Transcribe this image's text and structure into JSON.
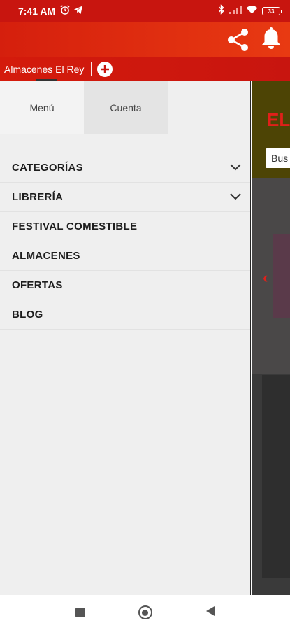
{
  "status_bar": {
    "time": "7:41 AM",
    "battery": "33",
    "icons": [
      "alarm-icon",
      "telegram-icon",
      "bluetooth-icon",
      "signal-icon",
      "wifi-icon",
      "battery-icon"
    ]
  },
  "app_header": {
    "icons": [
      "share-icon",
      "bell-icon"
    ],
    "color": "#d51f0d"
  },
  "tab_strip": {
    "tab_title": "Almacenes El Rey",
    "add_icon": "plus-circle-icon"
  },
  "drawer": {
    "tabs": [
      {
        "label": "Menú",
        "active": true
      },
      {
        "label": "Cuenta",
        "active": false
      }
    ],
    "items": [
      {
        "label": "CATEGORÍAS",
        "has_submenu": true
      },
      {
        "label": "LIBRERÍA",
        "has_submenu": true
      },
      {
        "label": "FESTIVAL COMESTIBLE",
        "has_submenu": false
      },
      {
        "label": "ALMACENES",
        "has_submenu": false
      },
      {
        "label": "OFERTAS",
        "has_submenu": false
      },
      {
        "label": "BLOG",
        "has_submenu": false
      }
    ]
  },
  "background_page": {
    "logo_text": "EL",
    "search_text": "Bus"
  },
  "nav_bar": {
    "icons": [
      "recents-square-icon",
      "home-circle-icon",
      "back-triangle-icon"
    ]
  }
}
